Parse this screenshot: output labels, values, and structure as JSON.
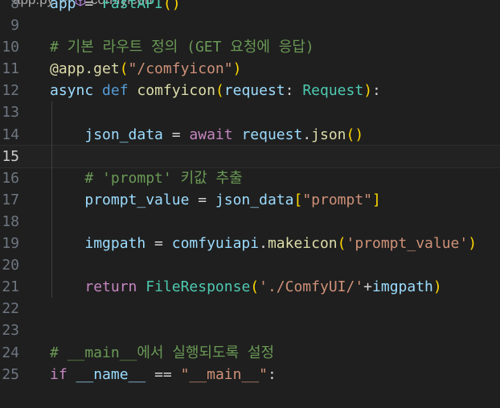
{
  "breadcrumb": {
    "file": "app.py",
    "separator": ">",
    "symbol": "comfyicon"
  },
  "theme": {
    "background": "#1f1f1f",
    "keyword": "#569cd6",
    "control": "#c586c0",
    "function": "#dcdcaa",
    "variable": "#9cdcfe",
    "string": "#ce9178",
    "class": "#4ec9b0",
    "comment": "#6a9955",
    "bracket_1": "#ffd700",
    "bracket_2": "#da70d6"
  },
  "editor": {
    "active_line": "15",
    "lines": [
      {
        "number": "8",
        "tokens": [
          [
            "var",
            "app"
          ],
          [
            "op",
            " = "
          ],
          [
            "cls",
            "FastAPI"
          ],
          [
            "br1",
            "()"
          ]
        ]
      },
      {
        "number": "9",
        "tokens": []
      },
      {
        "number": "10",
        "tokens": [
          [
            "com",
            "# 기본 라우트 정의 (GET 요청에 응답)"
          ]
        ]
      },
      {
        "number": "11",
        "tokens": [
          [
            "fn",
            "@app.get"
          ],
          [
            "br1",
            "("
          ],
          [
            "str",
            "\"/comfyicon\""
          ],
          [
            "br1",
            ")"
          ]
        ]
      },
      {
        "number": "12",
        "tokens": [
          [
            "var",
            "async"
          ],
          [
            "op",
            " "
          ],
          [
            "kw",
            "def"
          ],
          [
            "op",
            " "
          ],
          [
            "fn",
            "comfyicon"
          ],
          [
            "br1",
            "("
          ],
          [
            "var",
            "request"
          ],
          [
            "op",
            ": "
          ],
          [
            "cls",
            "Request"
          ],
          [
            "br1",
            ")"
          ],
          [
            "op",
            ":"
          ]
        ]
      },
      {
        "number": "13",
        "tokens": []
      },
      {
        "number": "14",
        "tokens": [
          [
            "op",
            "    "
          ],
          [
            "var",
            "json_data"
          ],
          [
            "op",
            " = "
          ],
          [
            "ctl",
            "await"
          ],
          [
            "op",
            " "
          ],
          [
            "var",
            "request"
          ],
          [
            "op",
            "."
          ],
          [
            "fn",
            "json"
          ],
          [
            "br1",
            "()"
          ]
        ]
      },
      {
        "number": "15",
        "tokens": []
      },
      {
        "number": "16",
        "tokens": [
          [
            "op",
            "    "
          ],
          [
            "com",
            "# 'prompt' 키값 추출"
          ]
        ]
      },
      {
        "number": "17",
        "tokens": [
          [
            "op",
            "    "
          ],
          [
            "var",
            "prompt_value"
          ],
          [
            "op",
            " = "
          ],
          [
            "var",
            "json_data"
          ],
          [
            "br1",
            "["
          ],
          [
            "str",
            "\"prompt\""
          ],
          [
            "br1",
            "]"
          ]
        ]
      },
      {
        "number": "18",
        "tokens": []
      },
      {
        "number": "19",
        "tokens": [
          [
            "op",
            "    "
          ],
          [
            "var",
            "imgpath"
          ],
          [
            "op",
            " = "
          ],
          [
            "var",
            "comfyuiapi"
          ],
          [
            "op",
            "."
          ],
          [
            "fn",
            "makeicon"
          ],
          [
            "br1",
            "("
          ],
          [
            "str",
            "'prompt_value'"
          ],
          [
            "br1",
            ")"
          ]
        ]
      },
      {
        "number": "20",
        "tokens": []
      },
      {
        "number": "21",
        "tokens": [
          [
            "op",
            "    "
          ],
          [
            "ctl",
            "return"
          ],
          [
            "op",
            " "
          ],
          [
            "cls",
            "FileResponse"
          ],
          [
            "br1",
            "("
          ],
          [
            "str",
            "'./ComfyUI/'"
          ],
          [
            "op",
            "+"
          ],
          [
            "var",
            "imgpath"
          ],
          [
            "br1",
            ")"
          ]
        ]
      },
      {
        "number": "22",
        "tokens": []
      },
      {
        "number": "23",
        "tokens": []
      },
      {
        "number": "24",
        "tokens": [
          [
            "com",
            "# __main__에서 실행되도록 설정"
          ]
        ]
      },
      {
        "number": "25",
        "tokens": [
          [
            "ctl",
            "if"
          ],
          [
            "op",
            " "
          ],
          [
            "var",
            "__name__"
          ],
          [
            "op",
            " == "
          ],
          [
            "str",
            "\"__main__\""
          ],
          [
            "op",
            ":"
          ]
        ]
      }
    ]
  }
}
